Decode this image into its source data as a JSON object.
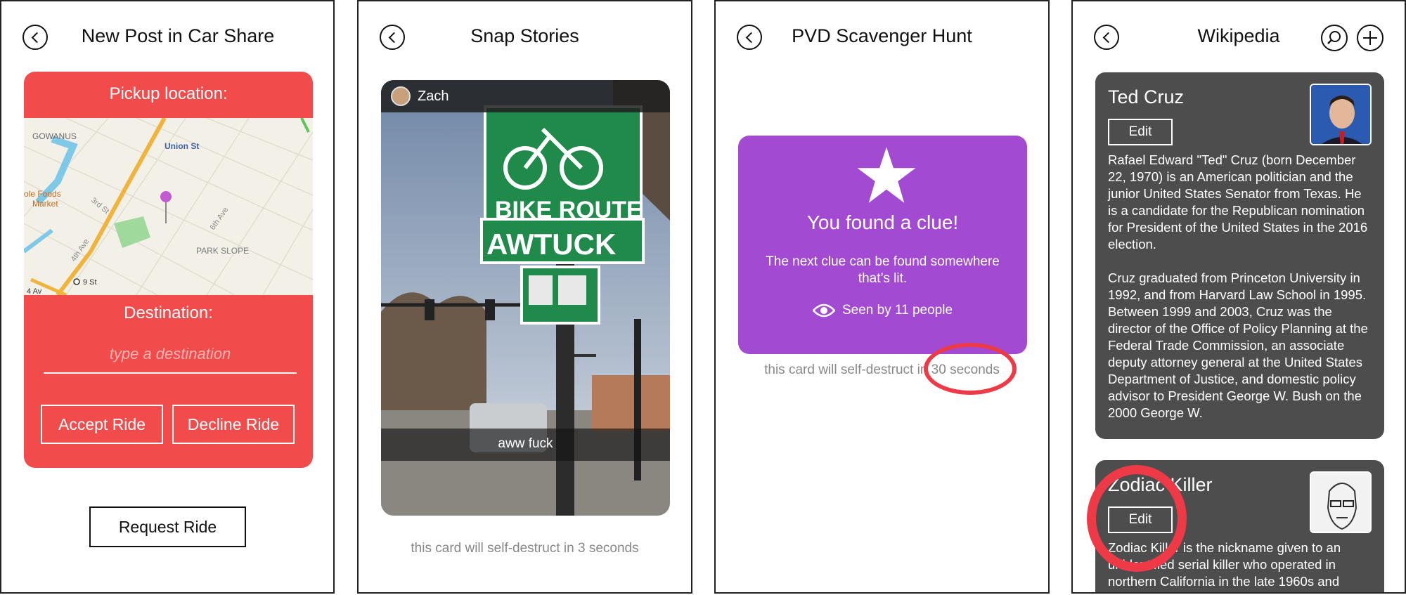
{
  "screens": {
    "car_share": {
      "title": "New Post in Car Share",
      "pickup_label": "Pickup location:",
      "map": {
        "labels": {
          "gowanus": "GOWANUS",
          "union_st": "Union St",
          "whole_foods": "ole Foods",
          "market": "Market",
          "third_st": "3rd St",
          "fourth_ave": "4th Ave",
          "sixth_ave": "6th Ave",
          "park_slope": "PARK SLOPE",
          "ninth_st": "9 St",
          "fourth_av": "4 Av"
        }
      },
      "destination_label": "Destination:",
      "destination_placeholder": "type a destination",
      "destination_value": "",
      "accept_label": "Accept Ride",
      "decline_label": "Decline Ride",
      "request_label": "Request Ride"
    },
    "snap_stories": {
      "title": "Snap Stories",
      "user": "Zach",
      "sign_text_1": "BIKE ROUTE",
      "sign_text_2": "AWTUCK",
      "caption": "aww fuck",
      "footer": "this card will self-destruct in 3 seconds"
    },
    "scavenger_hunt": {
      "title": "PVD Scavenger Hunt",
      "clue_title": "You found a clue!",
      "clue_body": "The next clue can be found somewhere that’s lit.",
      "seen_by": "Seen by 11 people",
      "footer": "this card will self-destruct in 30 seconds"
    },
    "wikipedia": {
      "title": "Wikipedia",
      "cards": [
        {
          "name": "Ted Cruz",
          "edit_label": "Edit",
          "text": "Rafael Edward \"Ted\" Cruz (born December 22, 1970) is an American politician and the junior United States Senator from Texas. He is a candidate for the Republican nomination for President of the United States in the 2016 election.",
          "text2": "Cruz graduated from Princeton University in 1992, and from Harvard Law School in 1995. Between 1999 and 2003, Cruz was the director of the Office of Policy Planning at the Federal Trade Commission, an associate deputy attorney general at the United States Department of Justice, and domestic policy advisor to President George W. Bush on the 2000 George W."
        },
        {
          "name": "Zodiac Killer",
          "edit_label": "Edit",
          "text": "Zodiac Killer is the nickname given to an unidentified serial killer who operated in northern California in the late 1960s and"
        }
      ]
    }
  },
  "colors": {
    "ride_card": "#f24b4b",
    "clue_card": "#a24bd2",
    "wiki_card": "#4d4d4d",
    "highlight": "#ed3a46"
  },
  "icons": [
    "back-arrow-icon",
    "search-icon",
    "plus-icon",
    "star-icon",
    "eye-icon",
    "map-pin-icon"
  ]
}
